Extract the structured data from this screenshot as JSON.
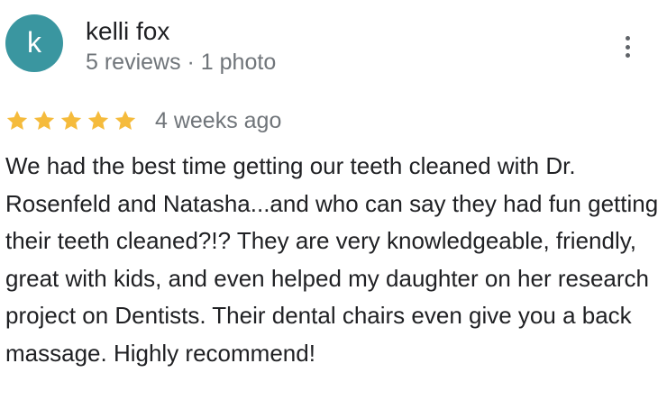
{
  "author": {
    "initial": "k",
    "name": "kelli fox",
    "meta": "5 reviews · 1 photo",
    "avatar_color": "#3a96a0"
  },
  "menu": {
    "icon": "more-vertical-icon"
  },
  "rating": {
    "stars": 5,
    "max_stars": 5,
    "star_color": "#f5bb3c",
    "date": "4 weeks ago"
  },
  "review": {
    "text": "We had the best time getting our teeth cleaned with Dr. Rosenfeld and Natasha...and who can say they had fun getting their teeth cleaned?!? They are very knowledgeable, friendly, great with kids, and even helped my daughter on her research project on Dentists. Their dental chairs even give you a back massage. Highly recommend!"
  }
}
